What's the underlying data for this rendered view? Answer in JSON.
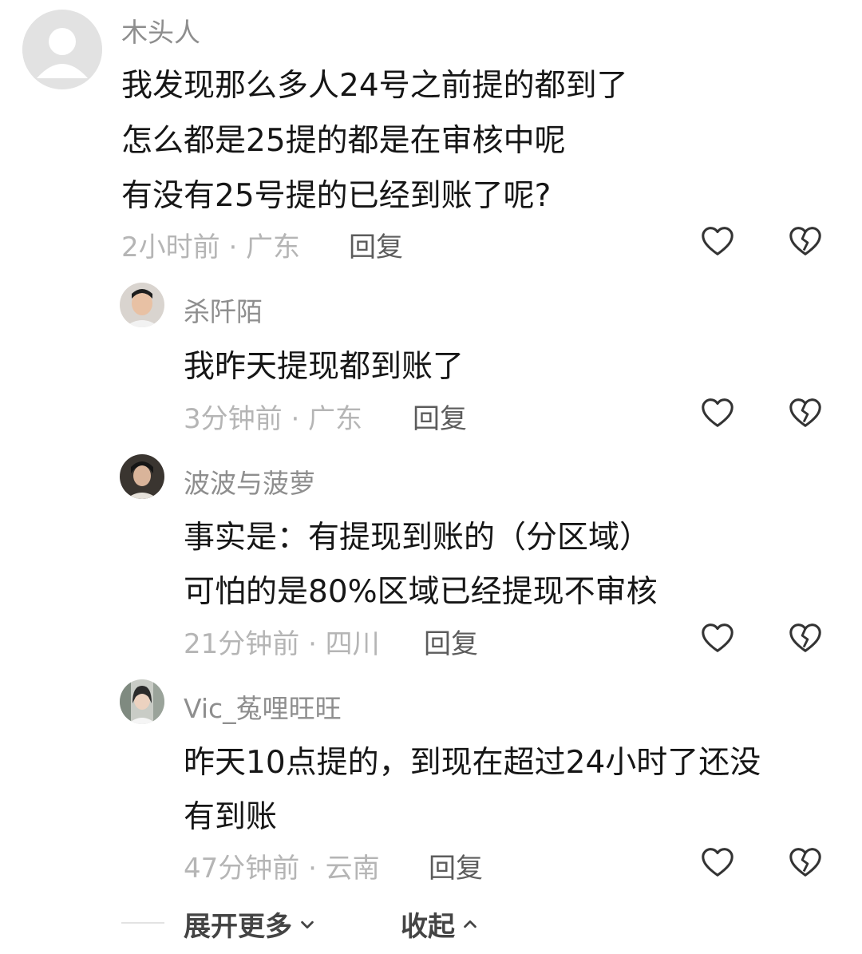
{
  "comments": [
    {
      "username": "木头人",
      "lines": [
        "我发现那么多人24号之前提的都到了",
        "怎么都是25提的都是在审核中呢",
        "有没有25号提的已经到账了呢?"
      ],
      "meta": "2小时前 · 广东",
      "reply_label": "回复"
    },
    {
      "username": "杀阡陌",
      "lines": [
        "我昨天提现都到账了"
      ],
      "meta": "3分钟前 · 广东",
      "reply_label": "回复"
    },
    {
      "username": "波波与菠萝",
      "lines": [
        "事实是：有提现到账的（分区域）",
        "可怕的是80%区域已经提现不审核"
      ],
      "meta": "21分钟前 · 四川",
      "reply_label": "回复"
    },
    {
      "username": "Vic_菟哩旺旺",
      "lines": [
        "昨天10点提的，到现在超过24小时了还没",
        "有到账"
      ],
      "meta": "47分钟前 · 云南",
      "reply_label": "回复"
    }
  ],
  "footer": {
    "expand_label": "展开更多",
    "collapse_label": "收起"
  },
  "icons": {
    "like": "heart-outline-icon",
    "dislike": "broken-heart-icon"
  }
}
